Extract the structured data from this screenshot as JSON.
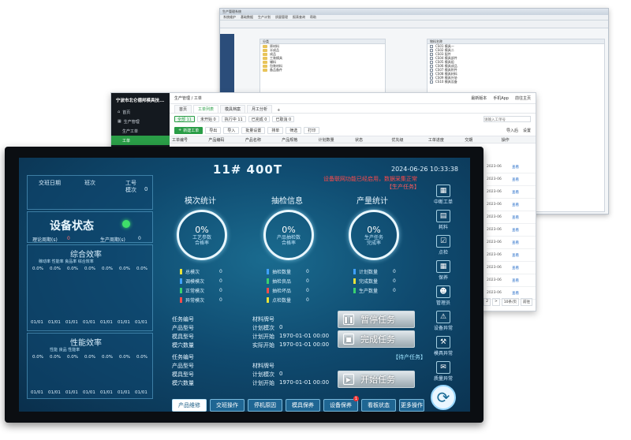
{
  "back_window": {
    "title": "生产管理系统",
    "menu": [
      "系统维护",
      "基础数据",
      "生产计划",
      "质量管理",
      "报表查询",
      "帮助"
    ],
    "left_panel_header": "分类",
    "left_items": [
      "原材料",
      "半成品",
      "成品",
      "工装模具",
      "辅料",
      "包装材料",
      "备品备件"
    ],
    "right_panel_header": "物料名称",
    "right_items": [
      "CS01 模具一",
      "CS02 模具二",
      "CS03 配件",
      "CS04 模具部件",
      "CS05 模具组",
      "CS06 模具成品",
      "CS07 模具附件",
      "CS08 模具材料",
      "CS09 模具外协",
      "CS10 模具设备"
    ]
  },
  "mid_window": {
    "brand": "宁波市北仑德邦模具技...",
    "sidebar": [
      {
        "label": "首页",
        "active": false
      },
      {
        "label": "生产管理",
        "active": false
      },
      {
        "label": "生产工单",
        "active": false
      },
      {
        "label": "工单",
        "active": true
      }
    ],
    "breadcrumb": "生产管理 / 工单",
    "top_actions": [
      "最新版本",
      "手机App",
      "前往主页"
    ],
    "tabs": [
      {
        "label": "首页",
        "active": false
      },
      {
        "label": "工单列表",
        "active": true
      },
      {
        "label": "模具档案",
        "active": false
      },
      {
        "label": "月工分析",
        "active": false
      }
    ],
    "filters": [
      "全部 11",
      "未开始 0",
      "执行中 11",
      "已完成 0",
      "已取消 0"
    ],
    "search_placeholder": "请输入工单号",
    "actions": [
      "新建工单",
      "导出",
      "导入",
      "批量设置",
      "排单",
      "筛选",
      "打印"
    ],
    "right_actions": [
      "导入后",
      "设置"
    ],
    "table_headers": [
      "工单编号",
      "产品编码",
      "产品名称",
      "产品规格",
      "计划数量",
      "状态",
      "优先级",
      "工单进度",
      "交期",
      "操作"
    ],
    "dates": [
      "2023-06",
      "2023-06",
      "2023-06",
      "2023-06",
      "2023-06",
      "2023-06",
      "2023-06",
      "2023-06",
      "2023-06",
      "2023-06",
      "2023-06"
    ],
    "row_action": "查看",
    "pager": {
      "pages": [
        "1",
        "2",
        ">"
      ],
      "size": "10条/页",
      "jump": "前往"
    }
  },
  "device": {
    "title": "11# 400T",
    "datetime": "2024-06-26 10:33:38",
    "marquee": "设备联网功能已经启用，数据采集正常",
    "left": {
      "meta_labels": [
        "交班日期",
        "班次",
        "工号",
        "模次"
      ],
      "meta_values": [
        "",
        "",
        "",
        "0"
      ],
      "status_title": "设备状态",
      "cycle_label": "理论周期(s)",
      "cycle_value": "0",
      "prod_cycle_label": "生产周期(s)",
      "prod_cycle_value": "0",
      "eff_title": "综合效率",
      "eff_legend": "稼动率 性能率 良品率 综合效率",
      "eff_values": [
        "0.0%",
        "0.0%",
        "0.0%",
        "0.0%",
        "0.0%",
        "0.0%",
        "0.0%"
      ],
      "eff_dates": [
        "01/01",
        "01/01",
        "01/01",
        "01/01",
        "01/01",
        "01/01",
        "01/01"
      ],
      "perf_title": "性能效率",
      "perf_legend": "性能 良品 性能率",
      "perf_values": [
        "0.0%",
        "0.0%",
        "0.0%",
        "0.0%",
        "0.0%",
        "0.0%",
        "0.0%"
      ],
      "perf_dates": [
        "01/01",
        "01/01",
        "01/01",
        "01/01",
        "01/01",
        "01/01",
        "01/01"
      ]
    },
    "sections": {
      "mold": "模次统计",
      "inspect": "抽检信息",
      "output": "产量统计"
    },
    "rings": [
      {
        "pct": "0%",
        "label": "工艺参数\n合格率"
      },
      {
        "pct": "0%",
        "label": "产品抽检数\n合格率"
      },
      {
        "pct": "0%",
        "label": "生产任务\n完成率"
      }
    ],
    "mold_legend": [
      {
        "label": "总模次",
        "value": "0",
        "color": "#e8e23a"
      },
      {
        "label": "调模模次",
        "value": "0",
        "color": "#3fa0ff"
      },
      {
        "label": "正常模次",
        "value": "0",
        "color": "#3bd16f"
      },
      {
        "label": "异常模次",
        "value": "0",
        "color": "#ff4b4b"
      }
    ],
    "inspect_legend": [
      {
        "label": "抽检数量",
        "value": "0",
        "color": "#3fa0ff"
      },
      {
        "label": "抽检良品",
        "value": "0",
        "color": "#3bd16f"
      },
      {
        "label": "抽检坏品",
        "value": "0",
        "color": "#ff4b4b"
      },
      {
        "label": "点检数量",
        "value": "0",
        "color": "#e8e23a"
      }
    ],
    "output_legend": [
      {
        "label": "计划数量",
        "value": "0",
        "color": "#3fa0ff"
      },
      {
        "label": "完成数量",
        "value": "0",
        "color": "#e8e23a"
      },
      {
        "label": "生产数量",
        "value": "0",
        "color": "#3bd16f"
      }
    ],
    "current_task_tag": "【生产任务】",
    "current_task_left": [
      "任务编号",
      "产品型号",
      "模具型号",
      "模穴数量"
    ],
    "current_task_right": [
      {
        "label": "材料牌号",
        "value": ""
      },
      {
        "label": "计划模次",
        "value": "0"
      },
      {
        "label": "计划开始",
        "value": "1970-01-01 00:00"
      },
      {
        "label": "实际开始",
        "value": "1970-01-01 00:00"
      }
    ],
    "pending_task_tag": "【待产任务】",
    "pending_task_left": [
      "任务编号",
      "产品型号",
      "模具型号",
      "模穴数量"
    ],
    "pending_task_right": [
      {
        "label": "材料牌号",
        "value": ""
      },
      {
        "label": "计划模次",
        "value": "0"
      },
      {
        "label": "计划开始",
        "value": "1970-01-01 00:00"
      }
    ],
    "btn_pause": "暂停任务",
    "btn_finish": "完成任务",
    "btn_start": "开始任务",
    "right_menu": [
      "中断工单",
      "耗料",
      "点检",
      "保养",
      "管理员",
      "设备异常",
      "模具异常",
      "质量异常"
    ],
    "bottom_nav": [
      {
        "label": "产品维修",
        "active": true
      },
      {
        "label": "交班操作",
        "active": false
      },
      {
        "label": "停机原因",
        "active": false
      },
      {
        "label": "模具保养",
        "active": false
      },
      {
        "label": "设备保养",
        "active": false
      },
      {
        "label": "看板状态",
        "active": false
      },
      {
        "label": "更多操作",
        "active": false
      }
    ],
    "device_badge": "1"
  }
}
